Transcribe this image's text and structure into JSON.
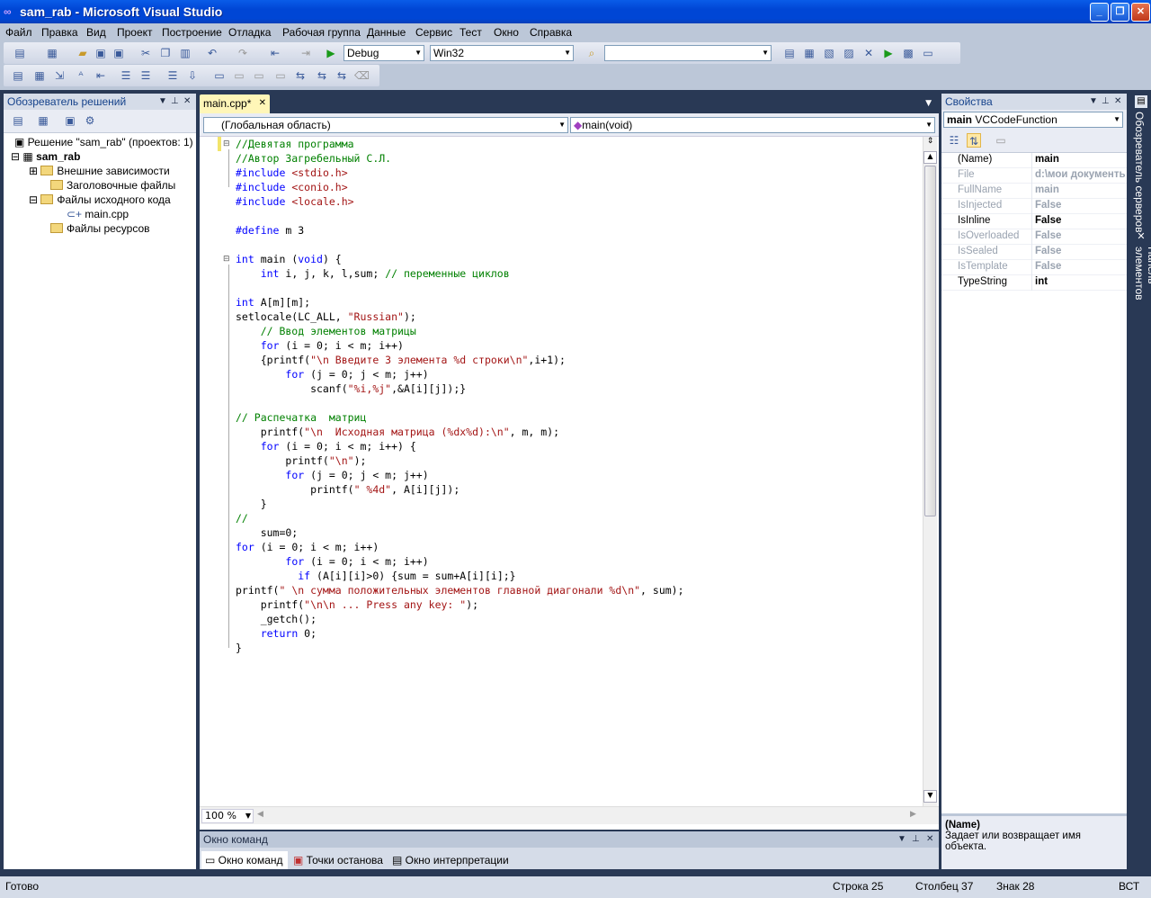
{
  "window": {
    "title": "sam_rab - Microsoft Visual Studio",
    "minimize": "_",
    "maximize": "❐",
    "close": "✕"
  },
  "menu": [
    "Файл",
    "Правка",
    "Вид",
    "Проект",
    "Построение",
    "Отладка",
    "Рабочая группа",
    "Данные",
    "Сервис",
    "Тест",
    "Окно",
    "Справка"
  ],
  "toolbar": {
    "config": "Debug",
    "platform": "Win32",
    "find": ""
  },
  "solution_explorer": {
    "title": "Обозреватель решений",
    "solution": "Решение \"sam_rab\" (проектов: 1)",
    "project": "sam_rab",
    "items": [
      "Внешние зависимости",
      "Заголовочные файлы",
      "Файлы исходного кода",
      "main.cpp",
      "Файлы ресурсов"
    ]
  },
  "editor": {
    "tab": "main.cpp*",
    "scope": "(Глобальная область)",
    "function": "main(void)",
    "zoom": "100 %"
  },
  "code": [
    "//Девятая программа",
    "//Автор Загребельный С.Л.",
    "#include <stdio.h>",
    "#include <conio.h>",
    "#include <locale.h>",
    "",
    "#define m 3",
    "",
    "int main (void) {",
    "    int i, j, k, l,sum; // переменные циклов",
    "",
    "int A[m][m];",
    "setlocale(LC_ALL, \"Russian\");",
    "    // Ввод элементов матрицы",
    "    for (i = 0; i < m; i++)",
    "    {printf(\"\\n Введите 3 элемента %d строки\\n\",i+1);",
    "        for (j = 0; j < m; j++)",
    "            scanf(\"%i,%j\",&A[i][j]);}",
    "",
    "// Распечатка  матриц",
    "    printf(\"\\n  Исходная матрица (%dx%d):\\n\", m, m);",
    "    for (i = 0; i < m; i++) {",
    "        printf(\"\\n\");",
    "        for (j = 0; j < m; j++)",
    "            printf(\" %4d\", A[i][j]);",
    "    }",
    "//",
    "    sum=0;",
    "for (i = 0; i < m; i++)",
    "        for (i = 0; i < m; i++)",
    "          if (A[i][i]>0) {sum = sum+A[i][i];}",
    "printf(\" \\n сумма положительных элементов главной диагонали %d\\n\", sum);",
    "    printf(\"\\n\\n ... Press any key: \");",
    "    _getch();",
    "    return 0;",
    "}"
  ],
  "properties": {
    "title": "Свойства",
    "object": "main",
    "object_type": "VCCodeFunction",
    "rows": [
      {
        "name": "(Name)",
        "value": "main",
        "dim": false
      },
      {
        "name": "File",
        "value": "d:\\мои документы",
        "dim": true
      },
      {
        "name": "FullName",
        "value": "main",
        "dim": true
      },
      {
        "name": "IsInjected",
        "value": "False",
        "dim": true
      },
      {
        "name": "IsInline",
        "value": "False",
        "dim": false
      },
      {
        "name": "IsOverloaded",
        "value": "False",
        "dim": true
      },
      {
        "name": "IsSealed",
        "value": "False",
        "dim": true
      },
      {
        "name": "IsTemplate",
        "value": "False",
        "dim": true
      },
      {
        "name": "TypeString",
        "value": "int",
        "dim": false
      }
    ],
    "desc_title": "(Name)",
    "desc_text": "Задает или возвращает имя объекта."
  },
  "side_tabs": [
    "Обозреватель серверов",
    "Панель элементов"
  ],
  "command_window": {
    "title": "Окно команд",
    "tabs": [
      "Окно команд",
      "Точки останова",
      "Окно интерпретации"
    ]
  },
  "status": {
    "ready": "Готово",
    "line": "Строка 25",
    "col": "Столбец 37",
    "ch": "Знак 28",
    "mode": "ВСТ"
  }
}
